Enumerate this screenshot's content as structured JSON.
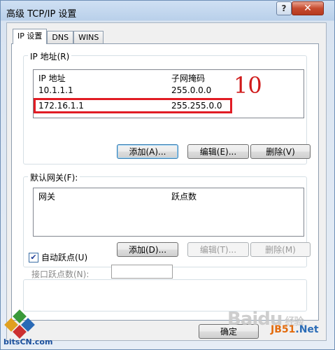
{
  "window": {
    "title": "高级 TCP/IP 设置",
    "help_glyph": "?",
    "close_glyph": "✕"
  },
  "tabs": [
    {
      "label": "IP 设置"
    },
    {
      "label": "DNS"
    },
    {
      "label": "WINS"
    }
  ],
  "ip_group": {
    "label": "IP 地址(R)",
    "columns": [
      "IP 地址",
      "子网掩码"
    ],
    "rows": [
      {
        "ip": "10.1.1.1",
        "mask": "255.0.0.0"
      },
      {
        "ip": "172.16.1.1",
        "mask": "255.255.0.0"
      }
    ],
    "buttons": {
      "add": "添加(A)...",
      "edit": "编辑(E)...",
      "delete": "删除(V)"
    }
  },
  "annotation": "10",
  "gateway_group": {
    "label": "默认网关(F):",
    "columns": [
      "网关",
      "跃点数"
    ],
    "buttons": {
      "add": "添加(D)...",
      "edit": "编辑(T)...",
      "delete": "删除(M)"
    }
  },
  "auto_metric": {
    "label": "自动跃点(U)",
    "checked": true,
    "check_glyph": "✔"
  },
  "interface_metric": {
    "label": "接口跃点数(N):",
    "value": ""
  },
  "ok_button": "确定",
  "watermarks": {
    "baidu": "Baidu",
    "baidu_cn": "经验",
    "jb51_a": "JB51",
    "jb51_b": ".Net",
    "bitscn": "bitsCN.com"
  }
}
